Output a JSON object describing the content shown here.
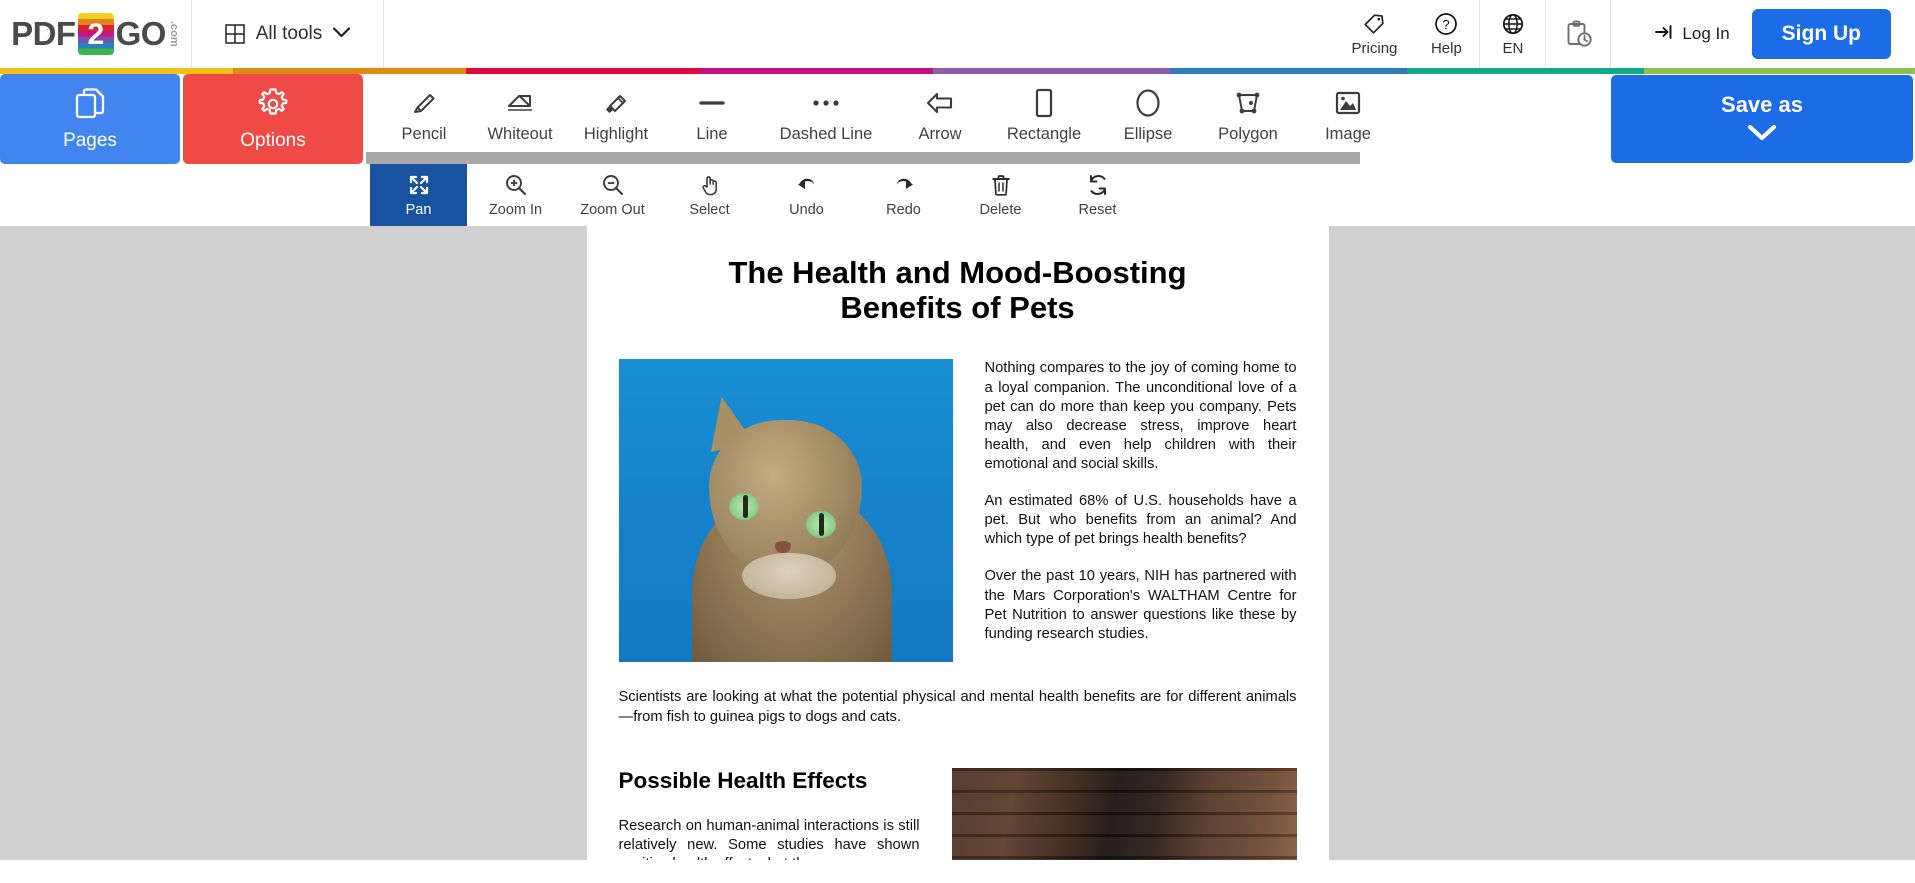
{
  "header": {
    "logo": {
      "part1": "PDF",
      "digit": "2",
      "part2": "GO",
      "suffix": ".com"
    },
    "all_tools_label": "All tools",
    "links": [
      {
        "label": "Pricing",
        "icon": "tag-icon"
      },
      {
        "label": "Help",
        "icon": "question-circle-icon"
      },
      {
        "label": "EN",
        "icon": "globe-icon"
      },
      {
        "label": "",
        "icon": "recent-files-icon"
      }
    ],
    "login_label": "Log In",
    "signup_label": "Sign Up",
    "signup_color": "#1c6ce8"
  },
  "stripe_colors": [
    "#f2c314",
    "#e08a12",
    "#e00b3c",
    "#c4107a",
    "#8b5fae",
    "#2c7dbd",
    "#12a98a",
    "#8cc152"
  ],
  "toolbar": {
    "pages": {
      "label": "Pages",
      "icon": "pages-icon",
      "color": "#4285ee"
    },
    "options": {
      "label": "Options",
      "icon": "gear-icon",
      "color": "#f04a46"
    },
    "tools": [
      {
        "label": "Pencil",
        "icon": "pencil-icon"
      },
      {
        "label": "Whiteout",
        "icon": "eraser-icon"
      },
      {
        "label": "Highlight",
        "icon": "highlighter-icon"
      },
      {
        "label": "Line",
        "icon": "line-icon"
      },
      {
        "label": "Dashed Line",
        "icon": "dashed-line-icon"
      },
      {
        "label": "Arrow",
        "icon": "arrow-left-icon"
      },
      {
        "label": "Rectangle",
        "icon": "rectangle-icon"
      },
      {
        "label": "Ellipse",
        "icon": "ellipse-icon"
      },
      {
        "label": "Polygon",
        "icon": "polygon-icon"
      },
      {
        "label": "Image",
        "icon": "image-icon"
      }
    ],
    "save_as": {
      "label": "Save as",
      "icon": "chevron-down-icon",
      "color": "#1c6ce8"
    }
  },
  "toolbar2": {
    "active": "Pan",
    "active_color": "#1852a0",
    "tools": [
      {
        "label": "Pan",
        "icon": "pan-icon"
      },
      {
        "label": "Zoom In",
        "icon": "zoom-in-icon"
      },
      {
        "label": "Zoom Out",
        "icon": "zoom-out-icon"
      },
      {
        "label": "Select",
        "icon": "pointer-hand-icon"
      },
      {
        "label": "Undo",
        "icon": "undo-icon"
      },
      {
        "label": "Redo",
        "icon": "redo-icon"
      },
      {
        "label": "Delete",
        "icon": "trash-icon"
      },
      {
        "label": "Reset",
        "icon": "reset-icon"
      }
    ]
  },
  "document": {
    "title": "The Health and Mood-Boosting Benefits of Pets",
    "image_caption": "cat-photo",
    "paragraphs": [
      "Nothing compares to the joy of coming home to a loyal companion. The unconditional love of a pet can do more than keep you company. Pets may also decrease stress, improve heart health, and even help children with their emotional and social skills.",
      "An estimated 68% of U.S. households have a pet. But who benefits from an animal? And which type of pet brings health benefits?",
      "Over the past 10 years, NIH has partnered with the Mars Corporation's WALTHAM Centre for Pet Nutrition to answer questions like these by funding research studies."
    ],
    "full_width_paragraph": "Scientists are looking at what the potential physical and mental health benefits are for different animals—from fish to guinea pigs to dogs and cats.",
    "section_heading": "Possible Health Effects",
    "section_paragraph": "Research on human-animal interactions is still relatively new. Some studies have shown positive health effects, but the"
  }
}
